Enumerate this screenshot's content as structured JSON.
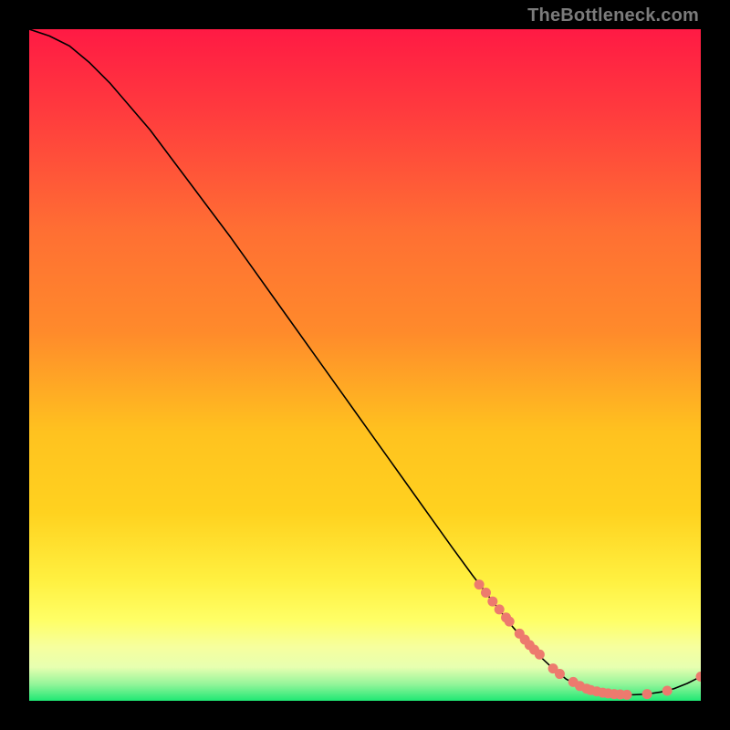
{
  "watermark": "TheBottleneck.com",
  "chart_data": {
    "type": "line",
    "title": "",
    "xlabel": "",
    "ylabel": "",
    "xlim": [
      0,
      100
    ],
    "ylim": [
      0,
      100
    ],
    "grid": false,
    "legend": false,
    "annotations": [],
    "series": [
      {
        "name": "curve",
        "kind": "line",
        "color": "#000000",
        "x": [
          0,
          3,
          6,
          9,
          12,
          15,
          18,
          21,
          24,
          27,
          30,
          33,
          36,
          39,
          42,
          45,
          48,
          51,
          54,
          57,
          60,
          63,
          66,
          69,
          72,
          75,
          78,
          80,
          82,
          84,
          86,
          88,
          90,
          92,
          94,
          96,
          98,
          100
        ],
        "y": [
          100,
          99,
          97.5,
          95,
          92,
          88.5,
          85,
          81,
          77,
          73,
          69,
          64.8,
          60.6,
          56.4,
          52.2,
          48,
          43.8,
          39.6,
          35.4,
          31.2,
          27,
          22.8,
          18.7,
          14.8,
          11,
          7.6,
          4.8,
          3.2,
          2.2,
          1.5,
          1.1,
          0.9,
          0.9,
          1.0,
          1.3,
          1.8,
          2.6,
          3.6
        ]
      },
      {
        "name": "markers",
        "kind": "scatter",
        "color": "#ED7A6E",
        "x": [
          67,
          68,
          69,
          70,
          71,
          71.5,
          73,
          73.8,
          74.5,
          75.2,
          76,
          78,
          79,
          81,
          82,
          83,
          83.6,
          84.5,
          85.4,
          86.2,
          87.1,
          88,
          89,
          92,
          95,
          100
        ],
        "y": [
          17.3,
          16.1,
          14.8,
          13.6,
          12.4,
          11.8,
          10.0,
          9.1,
          8.3,
          7.6,
          6.9,
          4.8,
          4.0,
          2.8,
          2.2,
          1.8,
          1.6,
          1.4,
          1.2,
          1.1,
          1.0,
          0.95,
          0.9,
          1.0,
          1.5,
          3.6
        ]
      }
    ],
    "background_gradient": {
      "top": "#FF1A44",
      "mid_upper": "#FF8A2B",
      "mid": "#FFD21F",
      "mid_lower": "#FFFF66",
      "lower": "#E7FFB0",
      "bottom": "#1FE874"
    }
  }
}
